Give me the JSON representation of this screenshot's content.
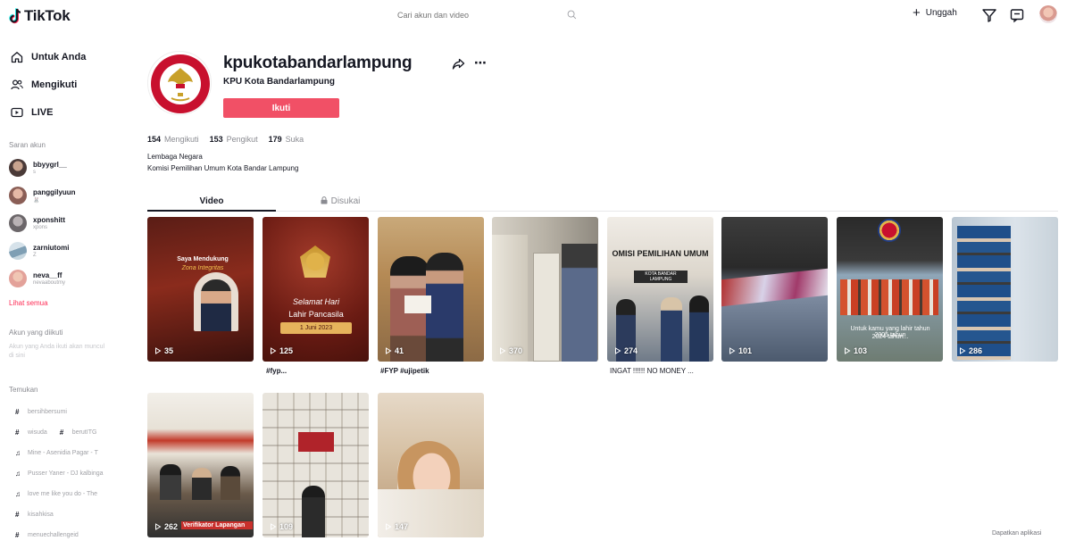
{
  "header": {
    "logo_text": "TikTok",
    "search_placeholder": "Cari akun dan video",
    "upload_label": "Unggah"
  },
  "sidebar": {
    "nav": [
      {
        "label": "Untuk Anda",
        "icon": "home-icon"
      },
      {
        "label": "Mengikuti",
        "icon": "people-icon"
      },
      {
        "label": "LIVE",
        "icon": "live-icon"
      }
    ],
    "suggested_heading": "Saran akun",
    "suggested_accounts": [
      {
        "name": "bbyygrl__",
        "sub": "s"
      },
      {
        "name": "panggilyuun",
        "sub": "🐰"
      },
      {
        "name": "xponshitt",
        "sub": "xpons"
      },
      {
        "name": "zarniutomi",
        "sub": "Z"
      },
      {
        "name": "neva__ff",
        "sub": "nevaaboutmy"
      }
    ],
    "see_all": "Lihat semua",
    "following_heading": "Akun yang diikuti",
    "following_hint": "Akun yang Anda ikuti akan muncul di sini",
    "discover_heading": "Temukan",
    "discover": [
      {
        "icon": "#",
        "label": "bersihbersumi"
      },
      {
        "icon": "#",
        "label": "wisuda",
        "icon2": "#",
        "label2": "berutITG"
      },
      {
        "icon": "♫",
        "label": "Mine - Asenidia Pagar - T"
      },
      {
        "icon": "♫",
        "label": "Pusser Yaner - DJ kalbinga"
      },
      {
        "icon": "♫",
        "label": "love me like you do - The"
      },
      {
        "icon": "#",
        "label": "kisahkisa"
      },
      {
        "icon": "#",
        "label": "menuechallengeid"
      }
    ],
    "get_app": "Dapatkan aplikasi"
  },
  "profile": {
    "username": "kpukotabandarlampung",
    "display_name": "KPU Kota Bandarlampung",
    "follow_label": "Ikuti",
    "stats": [
      {
        "value": "154",
        "label": "Mengikuti"
      },
      {
        "value": "153",
        "label": "Pengikut"
      },
      {
        "value": "179",
        "label": "Suka"
      }
    ],
    "bio_line1": "Lembaga Negara",
    "bio_line2": "Komisi Pemilihan Umum Kota Bandar Lampung"
  },
  "tabs": {
    "video": "Video",
    "liked": "Disukai"
  },
  "videos": [
    {
      "views": "35",
      "caption": "",
      "overlay1": "Saya Mendukung",
      "overlay2": "Zona Integritas"
    },
    {
      "views": "125",
      "caption": "#fyp...",
      "overlay1": "Selamat Hari",
      "overlay2": "Lahir Pancasila",
      "overlay3": "1 Juni 2023"
    },
    {
      "views": "41",
      "caption": "#FYP #ujipetik"
    },
    {
      "views": "370",
      "caption": ""
    },
    {
      "views": "274",
      "caption": "INGAT !!!!!! NO MONEY ...",
      "overlay1": "OMISI PEMILIHAN UMUM",
      "overlay2": "KOTA BANDAR LAMPUNG"
    },
    {
      "views": "101",
      "caption": ""
    },
    {
      "views": "103",
      "caption": "",
      "overlay1": "Untuk kamu yang lahir tahun 2005 tahun",
      "overlay2": "2024 tahun..."
    },
    {
      "views": "286",
      "caption": ""
    },
    {
      "views": "262",
      "caption": "",
      "overlay1": "Verifikator Lapangan"
    },
    {
      "views": "109",
      "caption": ""
    },
    {
      "views": "147",
      "caption": ""
    }
  ],
  "colors": {
    "accent": "#fe2c55",
    "follow_button": "#f15066",
    "text_primary": "#161823",
    "text_secondary": "#8a8b91"
  }
}
